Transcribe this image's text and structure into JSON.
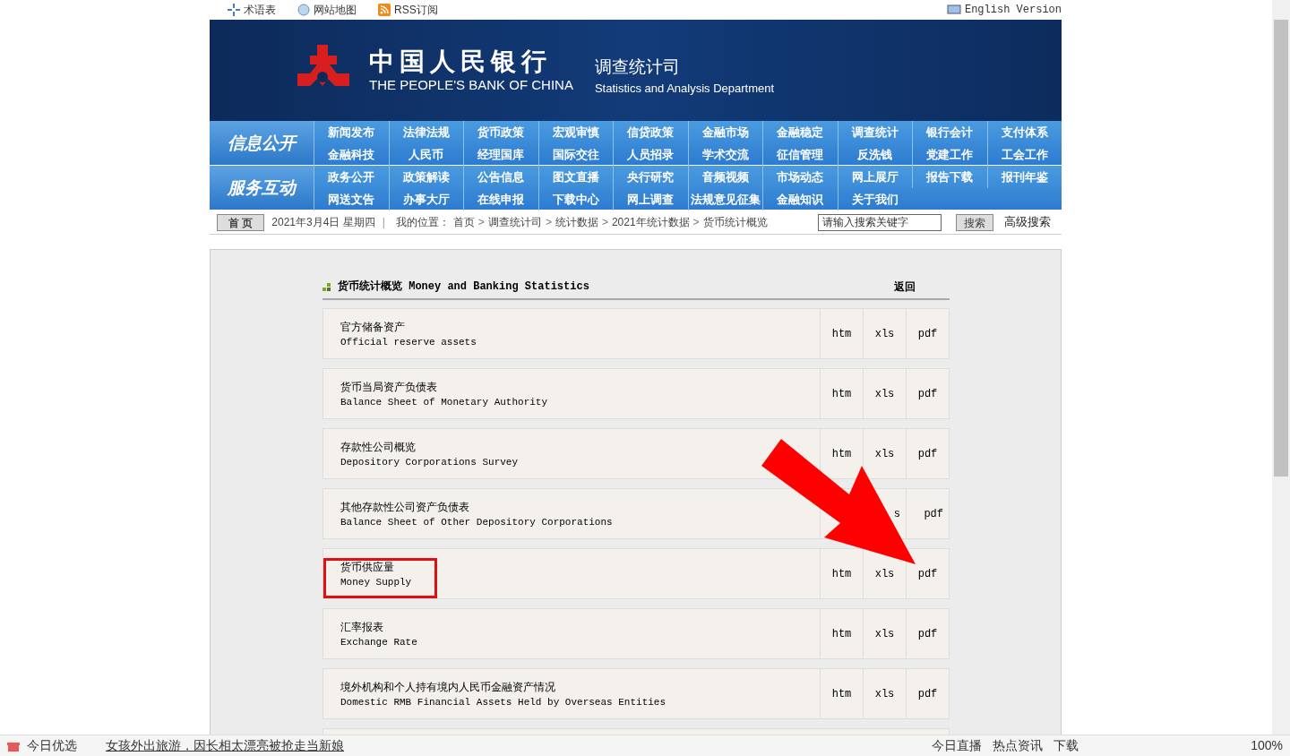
{
  "top_links": [
    {
      "label": "术语表"
    },
    {
      "label": "网站地图"
    },
    {
      "label": "RSS订阅"
    }
  ],
  "english_link": "English Version",
  "banner": {
    "name_cn": "中国人民银行",
    "name_en": "THE PEOPLE'S BANK OF CHINA",
    "dept_cn": "调查统计司",
    "dept_en": "Statistics and Analysis Department"
  },
  "nav_groups": [
    {
      "label": "信息公开",
      "items": [
        "新闻发布",
        "法律法规",
        "货币政策",
        "宏观审慎",
        "信贷政策",
        "金融市场",
        "金融稳定",
        "调查统计",
        "银行会计",
        "支付体系",
        "金融科技",
        "人民币",
        "经理国库",
        "国际交往",
        "人员招录",
        "学术交流",
        "征信管理",
        "反洗钱",
        "党建工作",
        "工会工作"
      ]
    },
    {
      "label": "服务互动",
      "items": [
        "政务公开",
        "政策解读",
        "公告信息",
        "图文直播",
        "央行研究",
        "音频视频",
        "市场动态",
        "网上展厅",
        "报告下载",
        "报刊年鉴",
        "网送文告",
        "办事大厅",
        "在线申报",
        "下载中心",
        "网上调查",
        "法规意见征集",
        "金融知识",
        "关于我们"
      ]
    }
  ],
  "breadcrumb_bar": {
    "home": "首 页",
    "date": "2021年3月4日  星期四",
    "divider": "|",
    "separator": ">",
    "location_label": "我的位置：",
    "path": [
      "首页",
      "调查统计司",
      "统计数据",
      "2021年统计数据",
      "货币统计概览"
    ],
    "search": {
      "placeholder": "请输入搜索关键字"
    },
    "search_button": "搜索",
    "advanced": "高级搜索"
  },
  "section": {
    "title": "货币统计概览 Money and Banking Statistics",
    "back": "返回"
  },
  "rows": [
    {
      "cn": "官方储备资产",
      "en": "Official reserve assets",
      "highlighted": false,
      "links": {
        "htm": "htm",
        "xls": "xls",
        "pdf": "pdf"
      }
    },
    {
      "cn": "货币当局资产负债表",
      "en": "Balance Sheet of Monetary Authority",
      "highlighted": false,
      "links": {
        "htm": "htm",
        "xls": "xls",
        "pdf": "pdf"
      }
    },
    {
      "cn": "存款性公司概览",
      "en": "Depository Corporations Survey",
      "highlighted": false,
      "links": {
        "htm": "htm",
        "xls": "xls",
        "pdf": "pdf"
      }
    },
    {
      "cn": "其他存款性公司资产负债表",
      "en": "Balance Sheet of Other Depository Corporations",
      "highlighted": false,
      "links": {
        "xls": "s",
        "pdf": "pdf"
      }
    },
    {
      "cn": "货币供应量",
      "en": "Money Supply",
      "highlighted": true,
      "links": {
        "htm": "htm",
        "xls": "xls",
        "pdf": "pdf"
      }
    },
    {
      "cn": "汇率报表",
      "en": "Exchange Rate",
      "highlighted": false,
      "links": {
        "htm": "htm",
        "xls": "xls",
        "pdf": "pdf"
      }
    },
    {
      "cn": "境外机构和个人持有境内人民币金融资产情况",
      "en": "Domestic RMB Financial Assets Held by Overseas Entities",
      "highlighted": false,
      "links": {
        "htm": "htm",
        "xls": "xls",
        "pdf": "pdf"
      }
    }
  ],
  "browser_status": {
    "left": "今日优选",
    "news": "女孩外出旅游，因长相太漂亮被抢走当新娘",
    "items": [
      "今日直播",
      "热点资讯",
      "下载"
    ],
    "zoom": "100%"
  }
}
